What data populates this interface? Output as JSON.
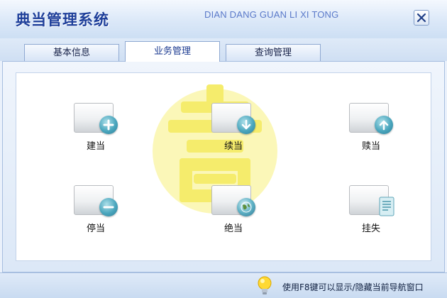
{
  "window": {
    "title": "典当管理系统",
    "title_pinyin": "DIAN DANG GUAN LI XI TONG",
    "close_icon": "close-icon"
  },
  "tabs": [
    {
      "label": "基本信息",
      "active": false
    },
    {
      "label": "业务管理",
      "active": true
    },
    {
      "label": "查询管理",
      "active": false
    }
  ],
  "items": [
    {
      "label": "建当",
      "icon": "plus-icon"
    },
    {
      "label": "续当",
      "icon": "arrow-down-icon"
    },
    {
      "label": "赎当",
      "icon": "arrow-up-icon"
    },
    {
      "label": "停当",
      "icon": "minus-icon"
    },
    {
      "label": "绝当",
      "icon": "globe-icon"
    },
    {
      "label": "挂失",
      "icon": "document-icon"
    }
  ],
  "status": {
    "text": "使用F8键可以显示/隐藏当前导航窗口",
    "icon": "lightbulb-icon"
  },
  "colors": {
    "title": "#1e3f9a",
    "watermark": "#f7f08a",
    "badge": "#4aa6bd"
  }
}
